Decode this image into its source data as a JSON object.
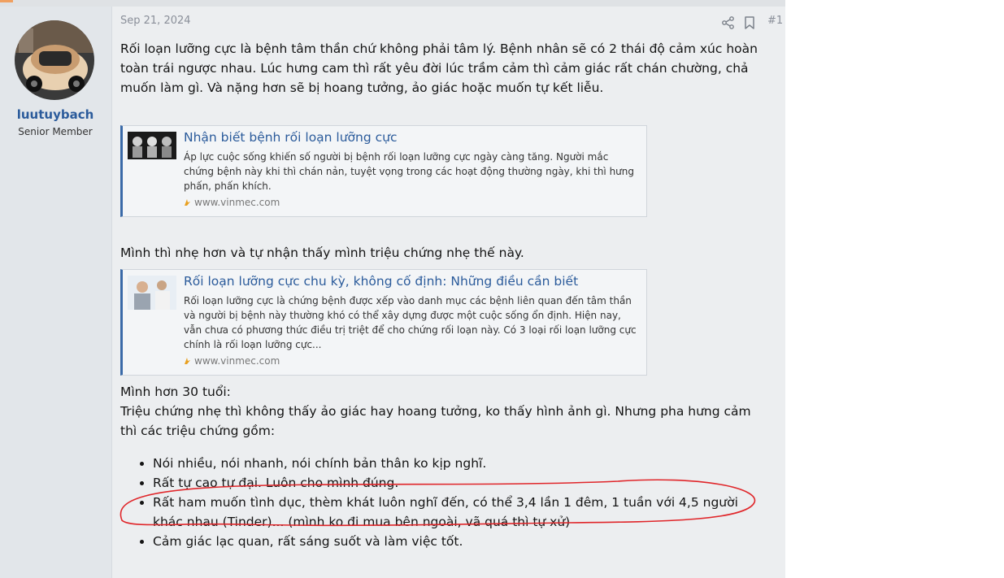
{
  "post": {
    "date": "Sep 21, 2024",
    "number": "#1",
    "author": {
      "name": "luutuybach",
      "title": "Senior Member"
    },
    "actions": [
      {
        "icon": "share-icon"
      },
      {
        "icon": "bookmark-icon"
      }
    ],
    "paragraph1": "Rối loạn lưỡng cực là bệnh tâm thần chứ không phải tâm lý. Bệnh nhân sẽ có 2 thái độ cảm xúc hoàn toàn trái ngược nhau. Lúc hưng cam thì rất yêu đời lúc trầm cảm thì cảm giác rất chán chường, chả muốn làm gì. Và nặng hơn sẽ bị hoang tưởng, ảo giác hoặc muốn tự kết liễu.",
    "link1": {
      "title": "Nhận biết bệnh rối loạn lưỡng cực",
      "description": "Áp lực cuộc sống khiến số người bị bệnh rối loạn lưỡng cực ngày càng tăng. Người mắc chứng bệnh này khi thì chán nản, tuyệt vọng trong các hoạt động thường ngày, khi thì hưng phấn, phấn khích.",
      "domain": "www.vinmec.com"
    },
    "paragraph2": "Mình thì nhẹ hơn và tự nhận thấy mình triệu chứng nhẹ thế này.",
    "link2": {
      "title": "Rối loạn lưỡng cực chu kỳ, không cố định: Những điều cần biết",
      "description": "Rối loạn lưỡng cực là chứng bệnh được xếp vào danh mục các bệnh liên quan đến tâm thần và người bị bệnh này thường khó có thể xây dựng được một cuộc sống ổn định. Hiện nay, vẫn chưa có phương thức điều trị triệt để cho chứng rối loạn này. Có 3 loại rối loạn lưỡng cực chính là rối loạn lưỡng cực...",
      "domain": "www.vinmec.com"
    },
    "age_line": "Mình hơn 30 tuổi:",
    "intro": "Triệu chứng nhẹ thì không thấy ảo giác hay hoang tưởng, ko thấy hình ảnh gì. Nhưng pha hưng cảm thì các triệu chứng gồm:",
    "symptoms": [
      "Nói nhiều, nói nhanh, nói chính bản thân ko kịp nghĩ.",
      "Rất tự cao tự đại. Luôn cho mình đúng.",
      "Rất ham muốn tình dục, thèm khát luôn nghĩ đến, có thể 3,4 lần 1 đêm, 1 tuần với 4,5 người khác nhau (Tinder)... (mình ko đi mua bên ngoài, vã quá thì tự xử)",
      "Cảm giác lạc quan, rất sáng suốt và làm việc tốt."
    ]
  },
  "colors": {
    "accent": "#2b5b9b",
    "annotation": "#e0262a"
  }
}
